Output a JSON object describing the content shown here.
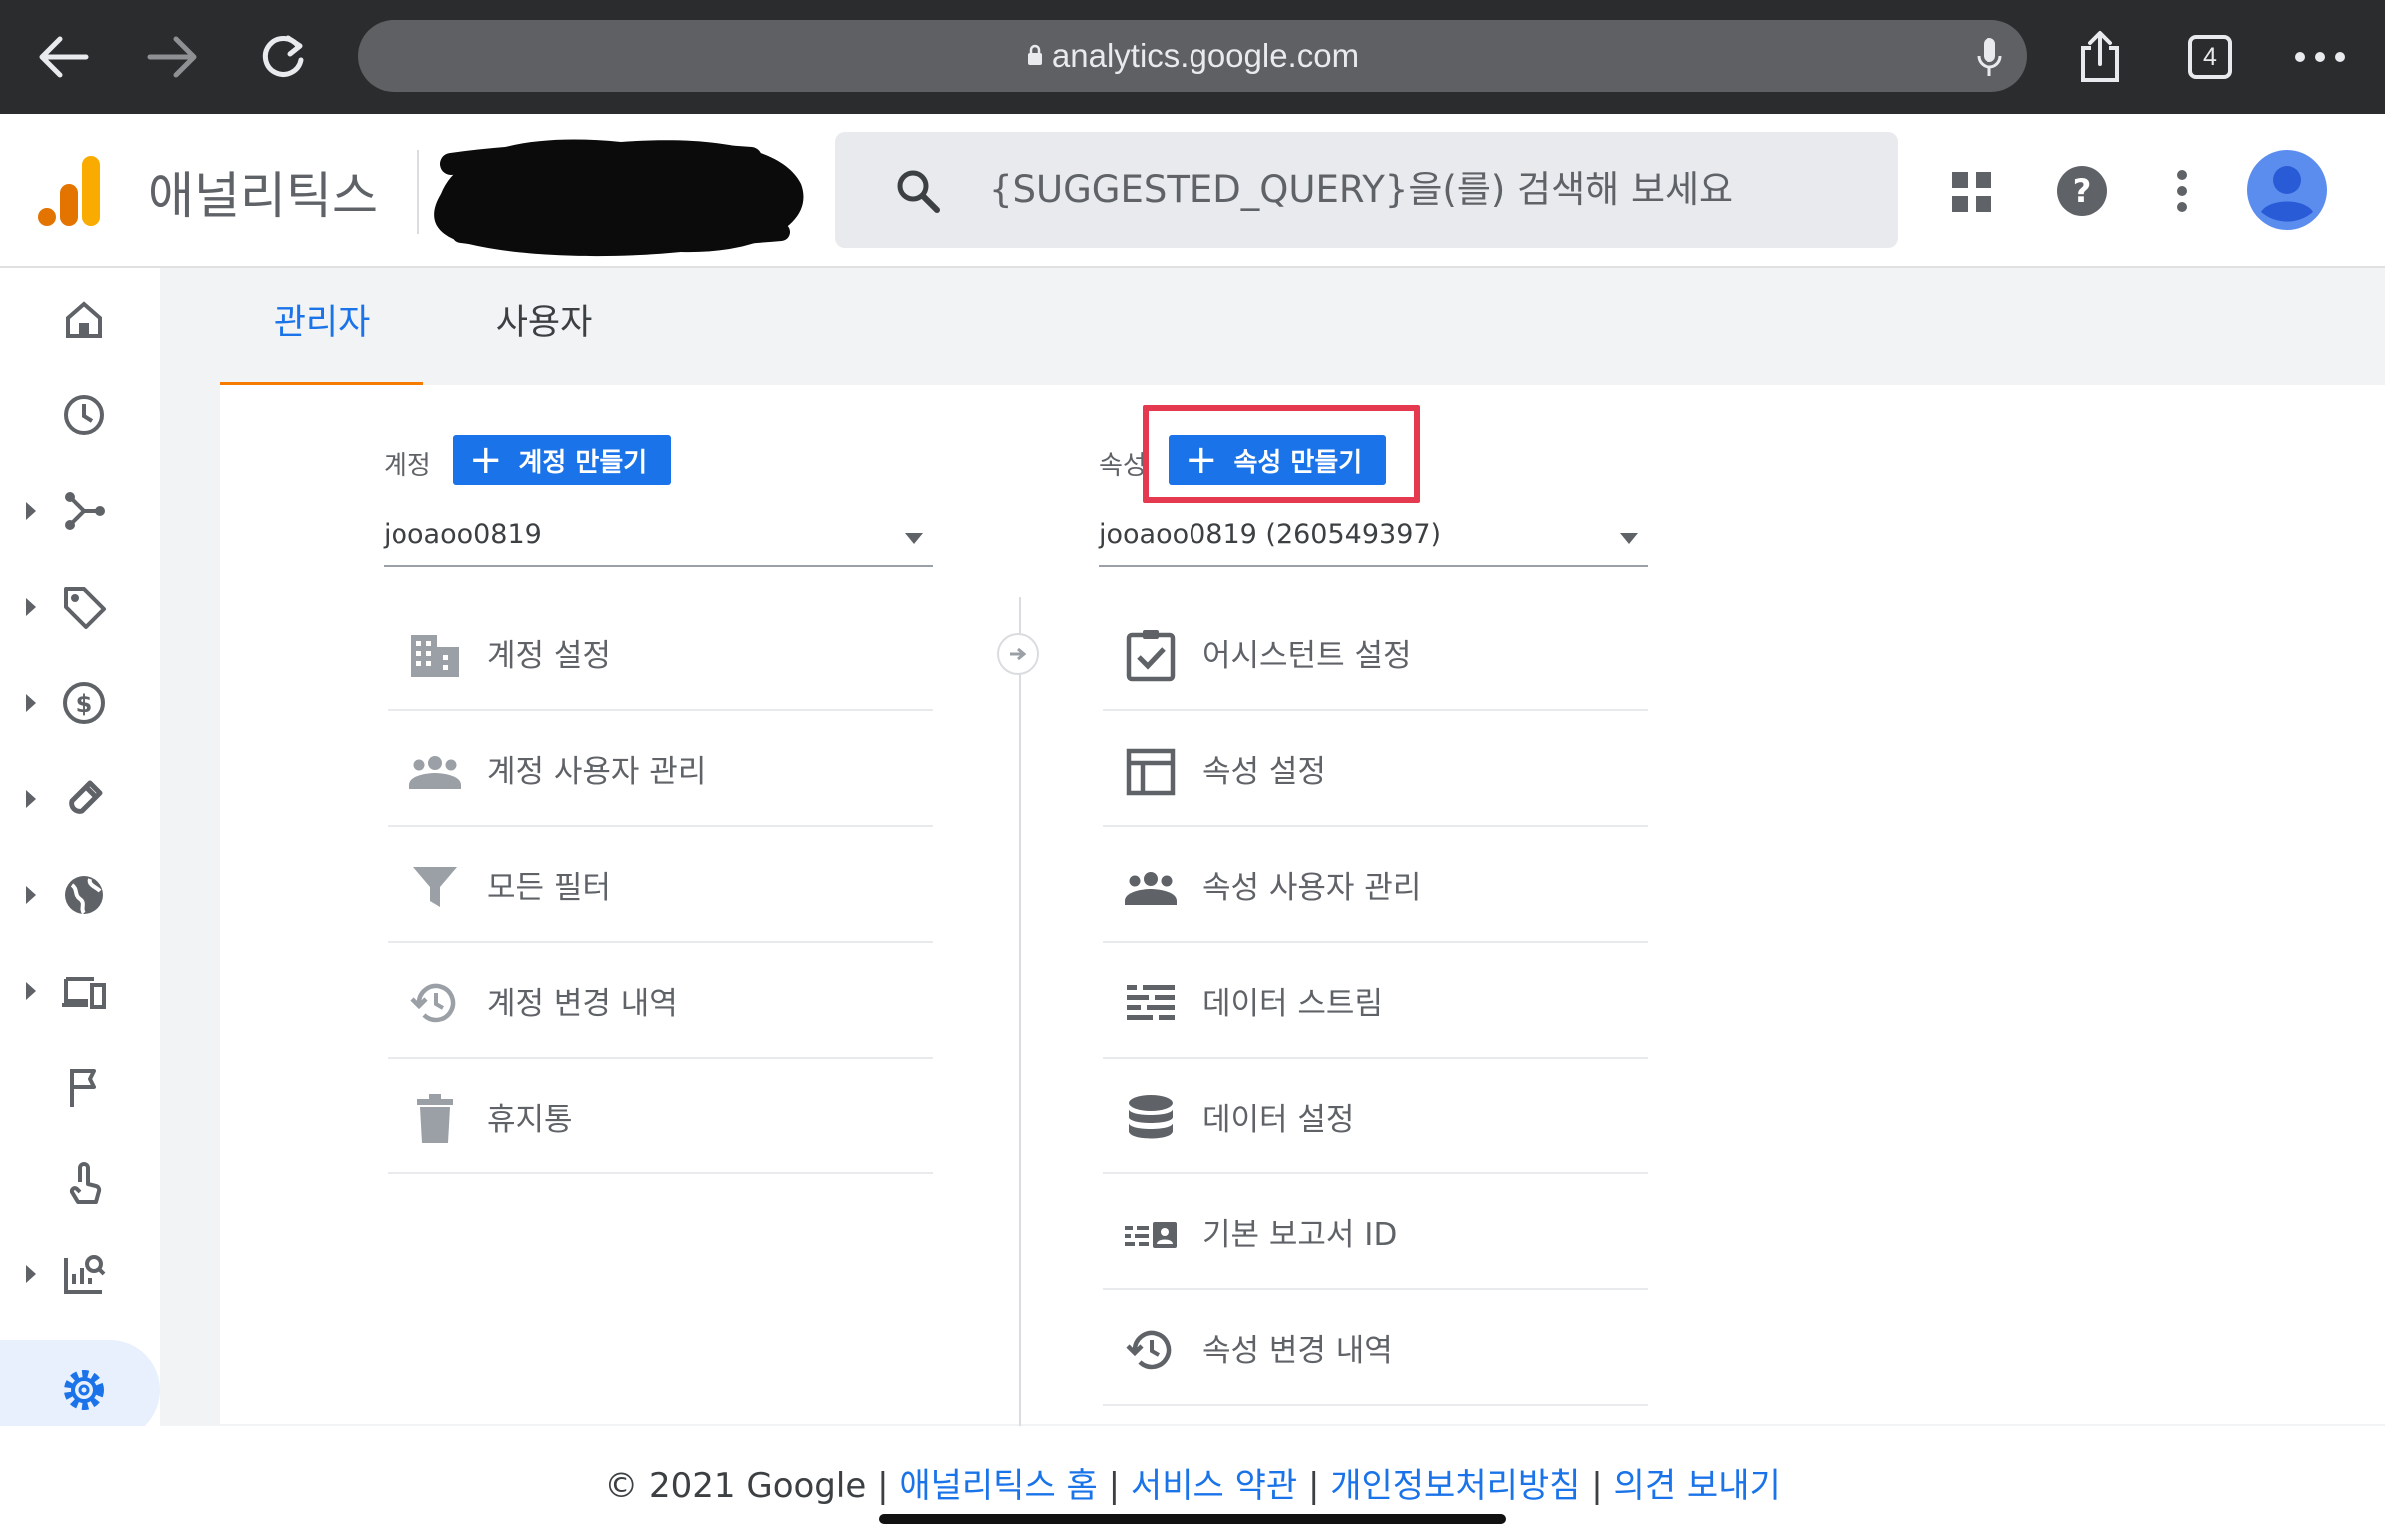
{
  "browser": {
    "url": "analytics.google.com",
    "tab_count": "4"
  },
  "header": {
    "brand": "애널리틱스",
    "search_placeholder": "{SUGGESTED_QUERY}을(를) 검색해 보세요"
  },
  "tabs": [
    {
      "label": "관리자",
      "active": true
    },
    {
      "label": "사용자",
      "active": false
    }
  ],
  "account_column": {
    "label": "계정",
    "create_button": "계정 만들기",
    "selected": "jooaoo0819",
    "items": [
      {
        "label": "계정 설정",
        "icon": "building-icon"
      },
      {
        "label": "계정 사용자 관리",
        "icon": "people-icon"
      },
      {
        "label": "모든 필터",
        "icon": "filter-icon"
      },
      {
        "label": "계정 변경 내역",
        "icon": "history-icon"
      },
      {
        "label": "휴지통",
        "icon": "trash-icon"
      }
    ]
  },
  "property_column": {
    "label": "속성",
    "create_button": "속성 만들기",
    "selected": "jooaoo0819 (260549397)",
    "items": [
      {
        "label": "어시스턴트 설정",
        "icon": "checklist-icon"
      },
      {
        "label": "속성 설정",
        "icon": "layout-icon"
      },
      {
        "label": "속성 사용자 관리",
        "icon": "people-icon"
      },
      {
        "label": "데이터 스트림",
        "icon": "streams-icon"
      },
      {
        "label": "데이터 설정",
        "icon": "database-icon"
      },
      {
        "label": "기본 보고서 ID",
        "icon": "id-card-icon"
      },
      {
        "label": "속성 변경 내역",
        "icon": "history-icon"
      }
    ]
  },
  "footer": {
    "copyright": "© 2021 Google",
    "links": [
      "애널리틱스 홈",
      "서비스 약관",
      "개인정보처리방침",
      "의견 보내기"
    ]
  },
  "colors": {
    "accent": "#1a73e8",
    "tab_indicator": "#f57c00",
    "highlight": "#e53950",
    "logo_orange": "#f9ab00",
    "logo_dark": "#e37400"
  }
}
